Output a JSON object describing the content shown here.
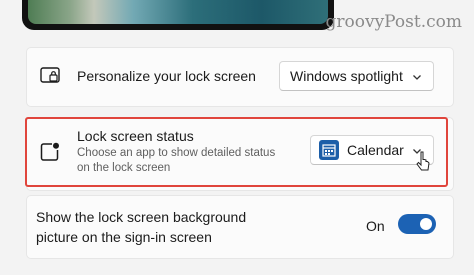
{
  "watermark": "groovyPost.com",
  "personalize": {
    "label": "Personalize your lock screen",
    "value": "Windows spotlight",
    "icon": "lock-screen-icon"
  },
  "status": {
    "label": "Lock screen status",
    "description_line1": "Choose an app to show detailed status",
    "description_line2": "on the lock screen",
    "value": "Calendar",
    "icon": "lock-screen-status-icon",
    "app_icon": "calendar-icon"
  },
  "signin": {
    "label_line1": "Show the lock screen background",
    "label_line2": "picture on the sign-in screen",
    "toggle_label": "On",
    "toggle_on": true
  },
  "colors": {
    "accent": "#1c62b4",
    "highlight": "#e0453c"
  }
}
